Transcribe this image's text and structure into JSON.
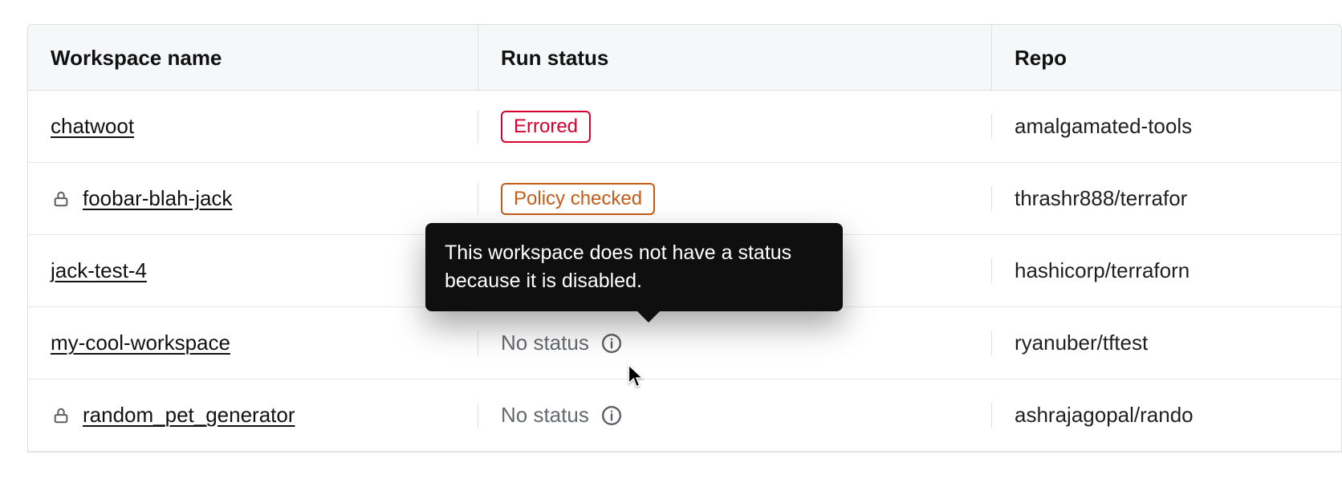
{
  "columns": {
    "name": "Workspace name",
    "status": "Run status",
    "repo": "Repo"
  },
  "tooltip": "This workspace does not have a status because it is disabled.",
  "rows": [
    {
      "name": "chatwoot",
      "locked": false,
      "status_kind": "badge",
      "status_text": "Errored",
      "status_class": "badge-errored",
      "repo": "amalgamated-tools"
    },
    {
      "name": "foobar-blah-jack",
      "locked": true,
      "status_kind": "badge",
      "status_text": "Policy checked",
      "status_class": "badge-policy",
      "repo": "thrashr888/terrafor"
    },
    {
      "name": "jack-test-4",
      "locked": false,
      "status_kind": "none",
      "status_text": "",
      "repo": "hashicorp/terraforn"
    },
    {
      "name": "my-cool-workspace",
      "locked": false,
      "status_kind": "nostatus",
      "status_text": "No status",
      "repo": "ryanuber/tftest"
    },
    {
      "name": "random_pet_generator",
      "locked": true,
      "status_kind": "nostatus",
      "status_text": "No status",
      "repo": "ashrajagopal/rando"
    }
  ]
}
